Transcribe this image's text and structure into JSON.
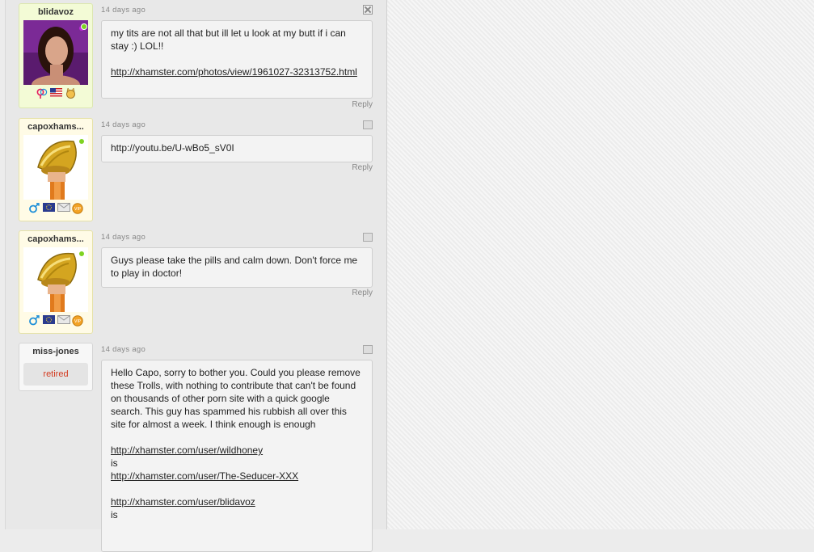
{
  "comments": [
    {
      "username": "blidavoz",
      "time": "14 days ago",
      "text": "my tits are not all that but ill let u look at my butt if i can stay :) LOL!!",
      "link": "http://xhamster.com/photos/view/1961027-32313752.html",
      "reply": "Reply"
    },
    {
      "username": "capoxhams...",
      "time": "14 days ago",
      "text": "http://youtu.be/U-wBo5_sV0I",
      "reply": "Reply",
      "vip": "VIP"
    },
    {
      "username": "capoxhams...",
      "time": "14 days ago",
      "text": "Guys please take the pills and calm down. Don't force me to play in doctor!",
      "reply": "Reply",
      "vip": "VIP"
    },
    {
      "username": "miss-jones",
      "status": "retired",
      "time": "14 days ago",
      "text": "Hello Capo, sorry to bother you. Could you please remove these Trolls, with nothing to contribute that can't be found on thousands of other porn site with a quick google search. This guy has spammed his rubbish all over this site for almost a week. I think enough is enough",
      "link1": "http://xhamster.com/user/wildhoney",
      "is1": "is",
      "link2": "http://xhamster.com/user/The-Seducer-XXX",
      "link3": "http://xhamster.com/user/blidavoz",
      "is2": "is"
    }
  ],
  "colors": {
    "online": "#7ed321",
    "retired_text": "#d33a1f",
    "female": "#e5195f",
    "male": "#1d8fd8"
  }
}
